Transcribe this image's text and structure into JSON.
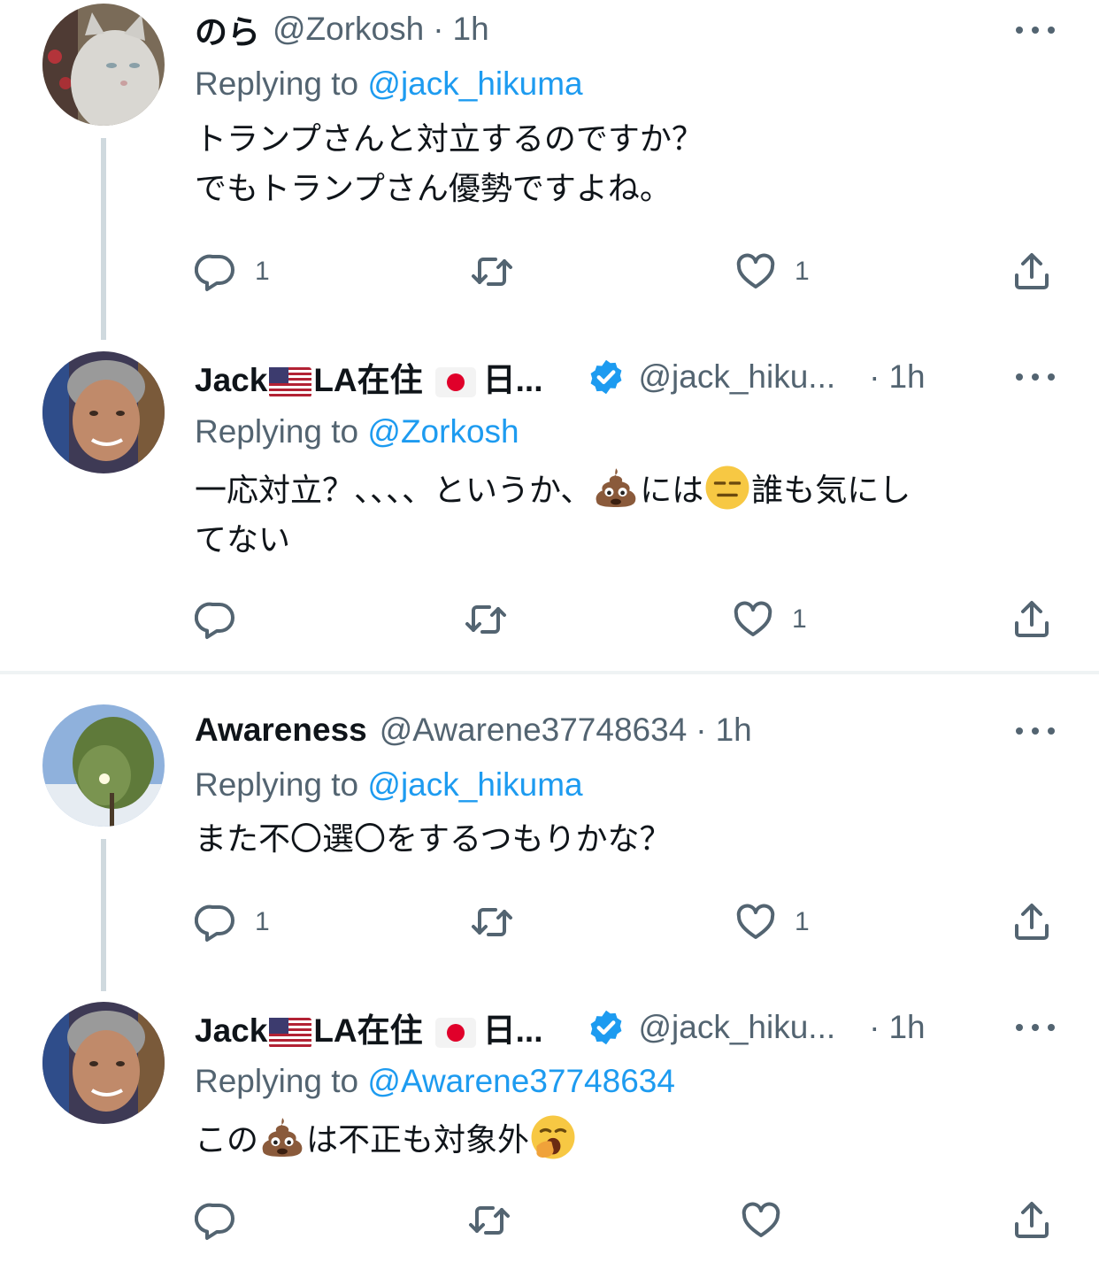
{
  "tweets": [
    {
      "name": "のら",
      "handle": "@Zorkosh",
      "time": "1h",
      "replying_label": "Replying to ",
      "replying_to": "@jack_hikuma",
      "text_lines": [
        "トランプさんと対立するのですか？",
        "でもトランプさん優勢ですよね。"
      ],
      "reply_count": "1",
      "retweet_count": "",
      "like_count": "1"
    },
    {
      "name": "Jack",
      "name_suffix": "LA在住",
      "name_tail": "日...",
      "handle": "@jack_hiku...",
      "time": "1h",
      "replying_label": "Replying to ",
      "replying_to": "@Zorkosh",
      "text_a": "一応対立？、、、、というか、",
      "text_b": "には",
      "text_c": "誰も気にし",
      "text_d": "てない",
      "reply_count": "",
      "retweet_count": "",
      "like_count": "1"
    },
    {
      "name": "Awareness",
      "handle": "@Awarene37748634",
      "time": "1h",
      "replying_label": "Replying to ",
      "replying_to": "@jack_hikuma",
      "text_lines": [
        "また不〇選〇をするつもりかな？"
      ],
      "reply_count": "1",
      "retweet_count": "",
      "like_count": "1"
    },
    {
      "name": "Jack",
      "name_suffix": "LA在住",
      "name_tail": "日...",
      "handle": "@jack_hiku...",
      "time": "1h",
      "replying_label": "Replying to ",
      "replying_to": "@Awarene37748634",
      "text_a": "この",
      "text_b": "は不正も対象外",
      "reply_count": "",
      "retweet_count": "",
      "like_count": ""
    }
  ],
  "separator": "·",
  "icons": [
    "reply-icon",
    "retweet-icon",
    "like-icon",
    "share-icon",
    "more-icon",
    "verified-badge-icon",
    "poop-emoji",
    "expressionless-emoji",
    "yawning-emoji",
    "us-flag-icon",
    "jp-flag-icon"
  ],
  "colors": {
    "accent": "#1d9bf0",
    "secondary_text": "#536471",
    "primary_text": "#0f1419",
    "thread_line": "#cfd9de"
  }
}
